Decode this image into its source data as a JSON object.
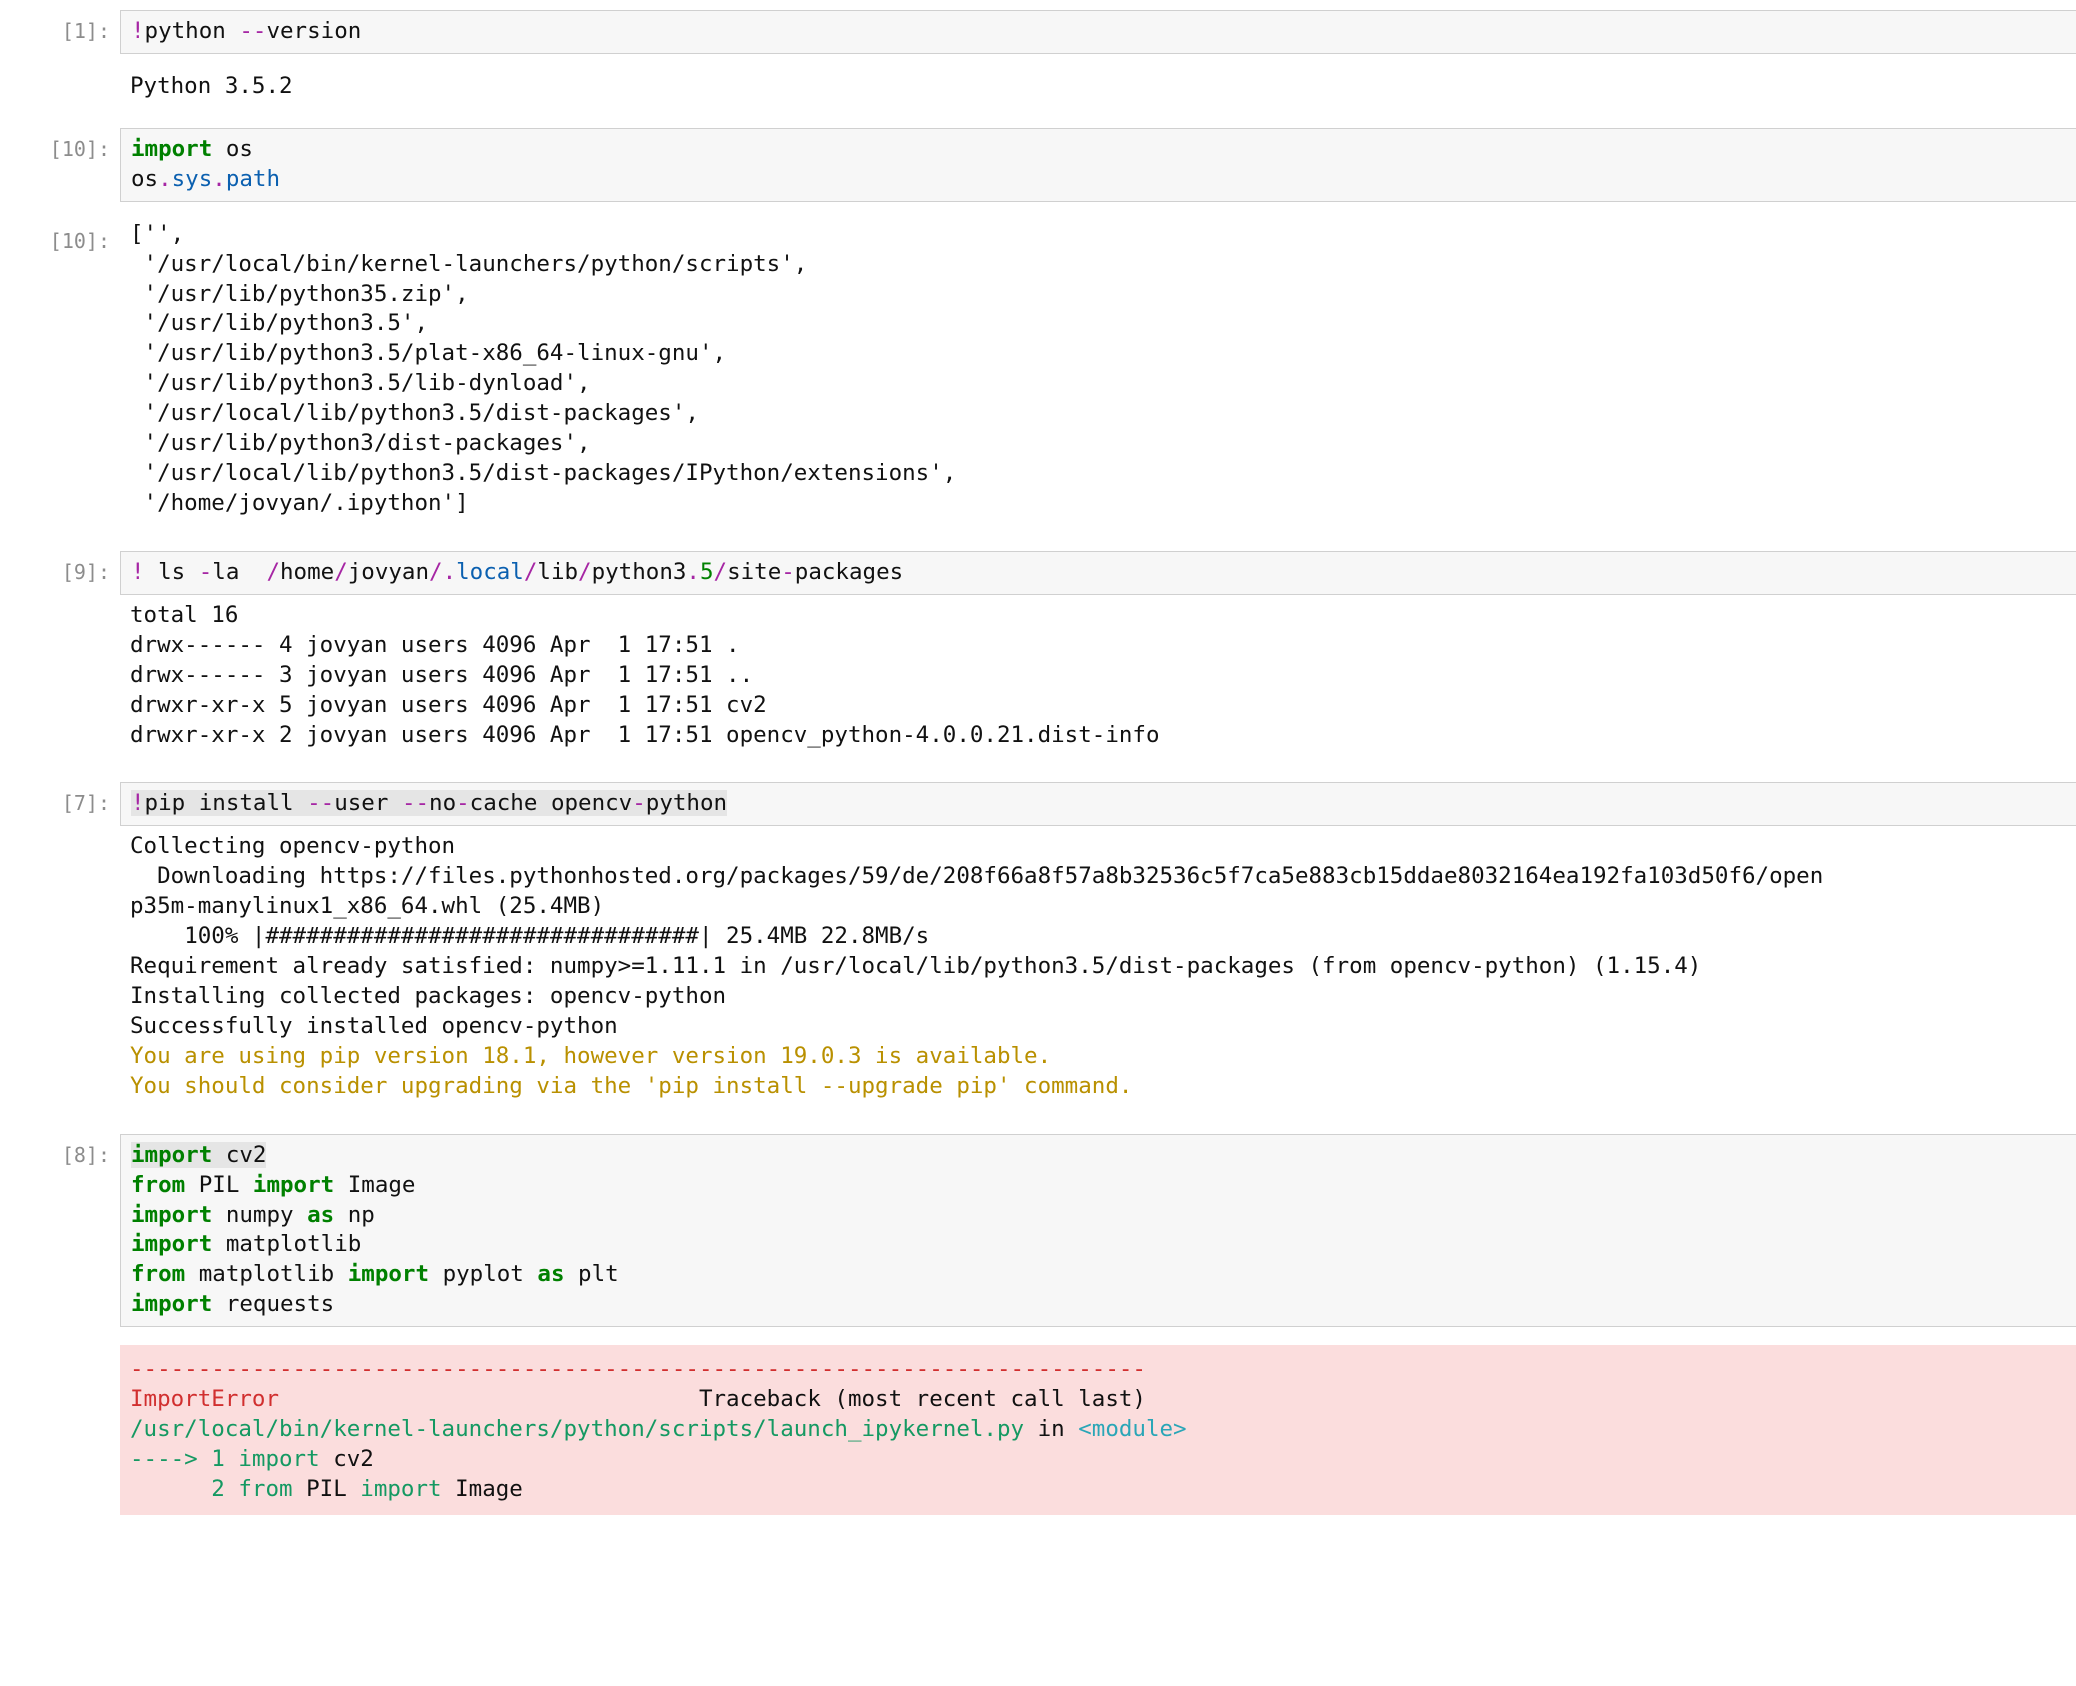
{
  "cells": {
    "c1": {
      "prompt": "[1]:",
      "input": "<span class=\"tok-op\">!</span>python <span class=\"tok-op\">--</span>version",
      "output_plain": "Python 3.5.2"
    },
    "c10a": {
      "prompt": "[10]:",
      "input": "<span class=\"tok-kw\">import</span> os\nos<span class=\"tok-op\">.</span><span class=\"tok-nm\">sys</span><span class=\"tok-op\">.</span><span class=\"tok-nm\">path</span>"
    },
    "c10b": {
      "prompt": "[10]:",
      "output_plain": "['',\n '/usr/local/bin/kernel-launchers/python/scripts',\n '/usr/lib/python35.zip',\n '/usr/lib/python3.5',\n '/usr/lib/python3.5/plat-x86_64-linux-gnu',\n '/usr/lib/python3.5/lib-dynload',\n '/usr/local/lib/python3.5/dist-packages',\n '/usr/lib/python3/dist-packages',\n '/usr/local/lib/python3.5/dist-packages/IPython/extensions',\n '/home/jovyan/.ipython']"
    },
    "c9": {
      "prompt": "[9]:",
      "input": "<span class=\"tok-op\">!</span> ls <span class=\"tok-op\">-</span>la  <span class=\"tok-op\">/</span>home<span class=\"tok-op\">/</span>jovyan<span class=\"tok-op\">/.</span><span class=\"tok-nm\">local</span><span class=\"tok-op\">/</span>lib<span class=\"tok-op\">/</span>python3<span class=\"tok-op\">.</span><span class=\"tok-num\">5</span><span class=\"tok-op\">/</span>site<span class=\"tok-op\">-</span>packages",
      "output_plain": "total 16\ndrwx------ 4 jovyan users 4096 Apr  1 17:51 .\ndrwx------ 3 jovyan users 4096 Apr  1 17:51 ..\ndrwxr-xr-x 5 jovyan users 4096 Apr  1 17:51 cv2\ndrwxr-xr-x 2 jovyan users 4096 Apr  1 17:51 opencv_python-4.0.0.21.dist-info"
    },
    "c7": {
      "prompt": "[7]:",
      "input": "<span class=\"hl-grey\"><span class=\"tok-op\">!</span>pip install <span class=\"tok-op\">--</span>user <span class=\"tok-op\">--</span>no<span class=\"tok-op\">-</span>cache opencv<span class=\"tok-op\">-</span>python</span>",
      "output_html": "Collecting opencv-python\n  Downloading https://files.pythonhosted.org/packages/59/de/208f66a8f57a8b32536c5f7ca5e883cb15ddae8032164ea192fa103d50f6/open\np35m-manylinux1_x86_64.whl (25.4MB)\n    100% |################################| 25.4MB 22.8MB/s\nRequirement already satisfied: numpy&gt;=1.11.1 in /usr/local/lib/python3.5/dist-packages (from opencv-python) (1.15.4)\nInstalling collected packages: opencv-python\nSuccessfully installed opencv-python\n<span class=\"warn\">You are using pip version 18.1, however version 19.0.3 is available.\nYou should consider upgrading via the 'pip install --upgrade pip' command.</span>"
    },
    "c8": {
      "prompt": "[8]:",
      "input": "<span class=\"hl-grey\"><span class=\"tok-kw\">import</span> cv2</span>\n<span class=\"tok-kw\">from</span> PIL <span class=\"tok-kw\">import</span> Image\n<span class=\"tok-kw\">import</span> numpy <span class=\"tok-kw\">as</span> np\n<span class=\"tok-kw\">import</span> matplotlib\n<span class=\"tok-kw\">from</span> matplotlib <span class=\"tok-kw\">import</span> pyplot <span class=\"tok-kw\">as</span> plt\n<span class=\"tok-kw\">import</span> requests",
      "error_html": "<span class=\"err-red\">---------------------------------------------------------------------------</span>\n<span class=\"err-red\">ImportError</span>                               Traceback (most recent call last)\n<span class=\"err-grn\">/usr/local/bin/kernel-launchers/python/scripts/launch_ipykernel.py</span> in <span class=\"err-cyn\">&lt;module&gt;</span>\n<span class=\"err-grn\">----&gt; 1</span> <span class=\"err-grn\">import</span> cv2\n      <span class=\"err-grn\">2</span> <span class=\"err-grn\">from</span> PIL <span class=\"err-grn\">import</span> Image"
    }
  }
}
